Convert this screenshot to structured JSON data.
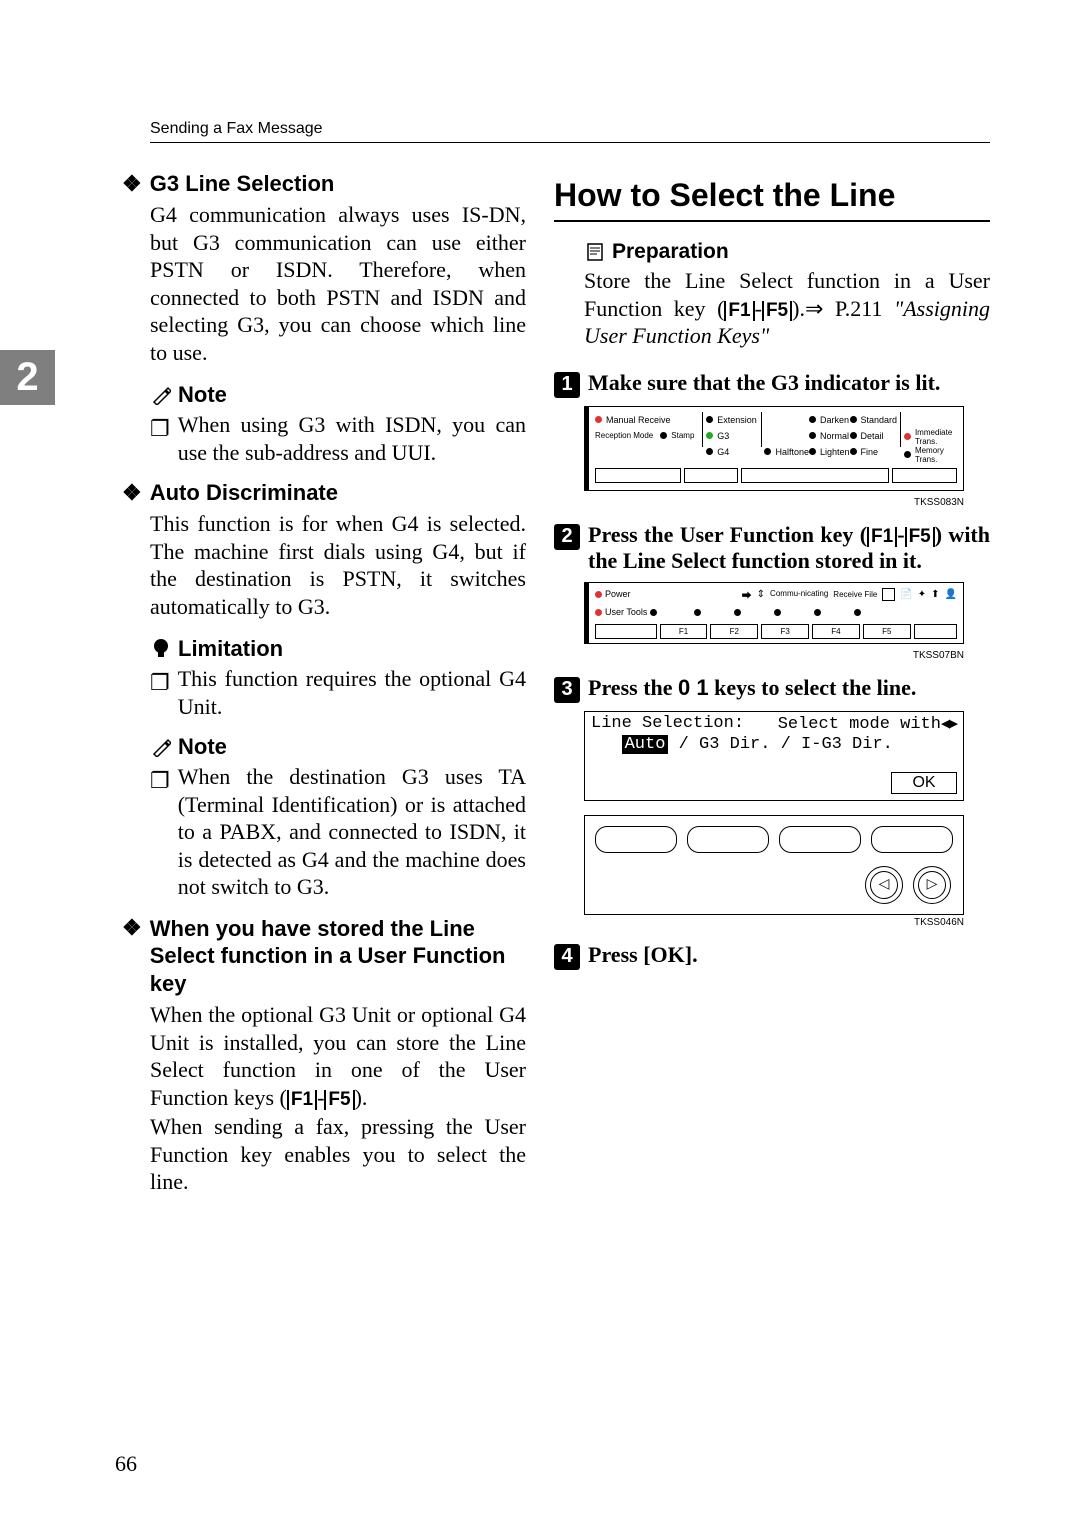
{
  "header": "Sending a Fax Message",
  "side_tab": "2",
  "page_number": "66",
  "icons": {
    "diamond": "❖",
    "note": "✎",
    "limitation": "💡",
    "prep": "📄",
    "bullet_square": "❐",
    "arrow": "⇒"
  },
  "left": {
    "items": [
      {
        "title": "G3 Line Selection",
        "body": "G4 communication always uses IS-DN, but G3 communication can use either PSTN or ISDN. Therefore, when connected to both PSTN and ISDN and selecting G3, you can choose which line to use.",
        "note": {
          "title": "Note",
          "bullets": [
            "When using G3 with ISDN, you can use the sub-address and UUI."
          ]
        }
      },
      {
        "title": "Auto Discriminate",
        "body": "This function is for when G4 is selected. The machine first dials using G4, but if the destination is PSTN, it switches automatically to G3.",
        "limitation": {
          "title": "Limitation",
          "bullets": [
            "This function requires the optional G4 Unit."
          ]
        },
        "note": {
          "title": "Note",
          "bullets": [
            "When the destination G3 uses TA (Terminal Identification) or is attached to a PABX, and connected to ISDN, it is detected as G4 and the machine does not switch to G3."
          ]
        }
      },
      {
        "title": "When you have stored the Line Select function in a User Function key",
        "body_pre": "When the optional G3 Unit or optional G4 Unit is installed, you can store the Line Select function in one of the User Function keys (",
        "key_range_f1": "F1",
        "key_range_f5": "F5",
        "body_post": ").",
        "body2": "When sending a fax, pressing the User Function key enables you to select the line."
      }
    ]
  },
  "right": {
    "h2": "How to Select the Line",
    "prep": {
      "title": "Preparation",
      "body_pre": "Store the Line Select function in a User Function key (",
      "key_f1": "F1",
      "key_f5": "F5",
      "body_mid": ").",
      "ref_page": "P.211",
      "ref_italic": "\"Assigning User Function Keys\""
    },
    "steps": [
      {
        "n": "1",
        "text": "Make sure that the G3 indicator is lit.",
        "fig_caption": "TKSS083N",
        "panel1": {
          "row1": [
            "Manual Receive",
            "Extension",
            "Darken",
            "Standard"
          ],
          "row2_left_label": "",
          "row2": [
            "G3",
            "Normal",
            "Detail",
            "Immediate Trans."
          ],
          "row3_left_label": "Reception Mode",
          "row3_left_label2": "Stamp",
          "row3": [
            "G4",
            "Halftone",
            "Lighten",
            "Fine",
            "Memory Trans."
          ]
        }
      },
      {
        "n": "2",
        "text_pre": "Press the User Function key (",
        "key_f1": "F1",
        "key_f5": "F5",
        "text_post": ") with the Line Select function stored in it.",
        "fig_caption": "TKSS07BN",
        "panel2": {
          "top_left": "Power",
          "commu": "Commu-nicating",
          "recv": "Receive File",
          "bottom_left": "User Tools",
          "fkeys": [
            "F1",
            "F2",
            "F3",
            "F4",
            "F5"
          ]
        }
      },
      {
        "n": "3",
        "text_pre": "Press the ",
        "keys": "0 1",
        "text_post": " keys to select the line.",
        "lcd": {
          "line1_left": "Line Selection:",
          "line1_right": "Select mode with",
          "line2_auto": "Auto",
          "line2_rest": " /  G3 Dir.  / I-G3 Dir.",
          "ok": "OK"
        },
        "fig_caption": "TKSS046N"
      },
      {
        "n": "4",
        "text": "Press [OK]."
      }
    ]
  }
}
